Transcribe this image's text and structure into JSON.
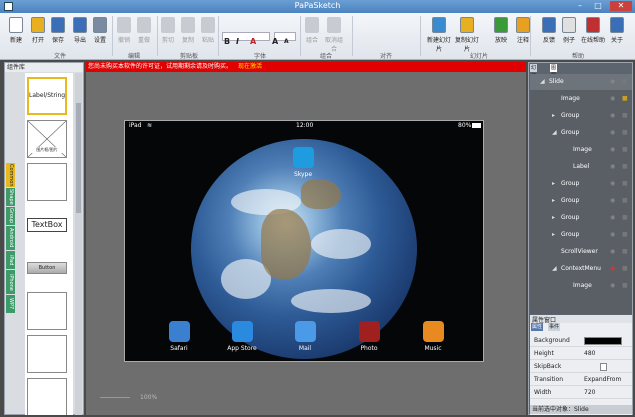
{
  "window": {
    "title": "PaPaSketch"
  },
  "ribbon": {
    "buttons": [
      {
        "label": "新建",
        "color": "#ffffff"
      },
      {
        "label": "打开",
        "color": "#e8b020"
      },
      {
        "label": "保存",
        "color": "#3a6fb7"
      },
      {
        "label": "导出",
        "color": "#3a6fb7"
      },
      {
        "label": "设置",
        "color": "#7a8aa0"
      },
      {
        "label": "撤销",
        "disabled": true
      },
      {
        "label": "重做",
        "disabled": true
      },
      {
        "label": "剪切",
        "disabled": true
      },
      {
        "label": "复制",
        "disabled": true
      },
      {
        "label": "粘贴",
        "disabled": true
      },
      {
        "label": "组合",
        "disabled": true
      },
      {
        "label": "取消组合",
        "disabled": true
      },
      {
        "label": "新建幻灯片",
        "color": "#3a8ad0"
      },
      {
        "label": "复制幻灯片",
        "color": "#e8b020"
      },
      {
        "label": "放映",
        "color": "#3a9a3a"
      },
      {
        "label": "注释",
        "color": "#e8a020"
      },
      {
        "label": "反馈",
        "color": "#3a6fb7"
      },
      {
        "label": "例子",
        "color": "#e0e0e0"
      },
      {
        "label": "在线帮助",
        "color": "#c03030"
      },
      {
        "label": "关于",
        "color": "#3a6fb7"
      }
    ],
    "groups": [
      "文件",
      "编辑",
      "剪贴板",
      "字体",
      "组合",
      "对齐",
      "幻灯片",
      "帮助"
    ],
    "format": {
      "bold": "B",
      "italic": "I",
      "color": "A",
      "grow": "A",
      "shrink": "A"
    }
  },
  "left_panel": {
    "title": "组件库",
    "tabs": [
      "Common",
      "Shape",
      "Group",
      "Android",
      "iPad",
      "iPhone",
      "WP7"
    ],
    "active_tab": "Common",
    "tiles": [
      "Label/String",
      "",
      "",
      "TextBox",
      "Button",
      "",
      "",
      ""
    ],
    "tile_caption_small": "图片框/图片"
  },
  "canvas": {
    "notice": "您尚未购买本软件的许可证，试用期剩余请及时购买。",
    "notice_action": "现在激活",
    "zoom": "100%",
    "ipad": {
      "device": "iPad",
      "time": "12:00",
      "battery": "80%",
      "apps": [
        {
          "name": "Skype",
          "color": "#1f9ce0"
        },
        {
          "name": "Safari",
          "color": "#3a7fd0"
        },
        {
          "name": "App Store",
          "color": "#2a8ae0"
        },
        {
          "name": "Mail",
          "color": "#4a9ae8"
        },
        {
          "name": "Photo",
          "color": "#a02020"
        },
        {
          "name": "Music",
          "color": "#e88a20"
        }
      ]
    }
  },
  "right_panel": {
    "tabs": [
      "幻灯片",
      "图层"
    ],
    "outline": [
      {
        "label": "Slide",
        "depth": 0,
        "arrow": "collapse",
        "selected": true
      },
      {
        "label": "Image",
        "depth": 1,
        "arrow": "",
        "locked": true
      },
      {
        "label": "Group",
        "depth": 1,
        "arrow": "expand"
      },
      {
        "label": "Group",
        "depth": 1,
        "arrow": "collapse"
      },
      {
        "label": "Image",
        "depth": 2,
        "arrow": ""
      },
      {
        "label": "Label",
        "depth": 2,
        "arrow": ""
      },
      {
        "label": "Group",
        "depth": 1,
        "arrow": "expand"
      },
      {
        "label": "Group",
        "depth": 1,
        "arrow": "expand"
      },
      {
        "label": "Group",
        "depth": 1,
        "arrow": "expand"
      },
      {
        "label": "Group",
        "depth": 1,
        "arrow": "expand"
      },
      {
        "label": "ScrollViewer",
        "depth": 1,
        "arrow": ""
      },
      {
        "label": "ContextMenu",
        "depth": 1,
        "arrow": "collapse",
        "eye_on": true
      },
      {
        "label": "Image",
        "depth": 2,
        "arrow": ""
      }
    ],
    "props": {
      "title": "属性窗口",
      "tabs": [
        "属性",
        "事件"
      ],
      "rows": [
        {
          "name": "Background",
          "value": ""
        },
        {
          "name": "Height",
          "value": "480"
        },
        {
          "name": "SkipBack",
          "value": ""
        },
        {
          "name": "Transition",
          "value": "ExpandFrom"
        },
        {
          "name": "Width",
          "value": "720"
        }
      ],
      "status": "当前选中对象：Slide"
    }
  }
}
